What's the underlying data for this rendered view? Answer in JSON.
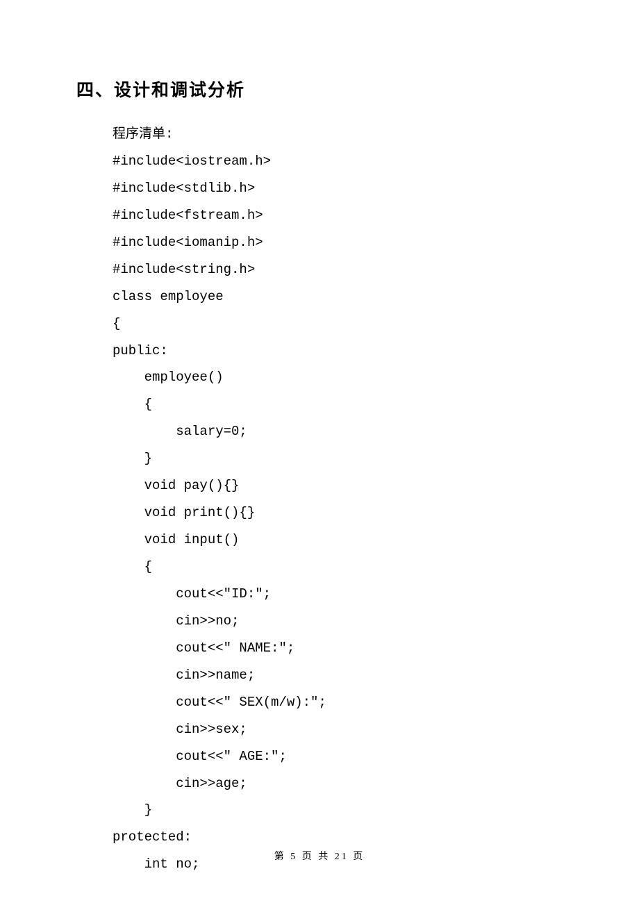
{
  "heading": "四、设计和调试分析",
  "lines": [
    "程序清单:",
    "#include<iostream.h>",
    "#include<stdlib.h>",
    "#include<fstream.h>",
    "#include<iomanip.h>",
    "#include<string.h>",
    "class employee",
    "{",
    "public:",
    "    employee()",
    "    {",
    "        salary=0;",
    "    }",
    "    void pay(){}",
    "    void print(){}",
    "    void input()",
    "    {",
    "        cout<<\"ID:\";",
    "        cin>>no;",
    "        cout<<\" NAME:\";",
    "        cin>>name;",
    "        cout<<\" SEX(m/w):\";",
    "        cin>>sex;",
    "        cout<<\" AGE:\";",
    "        cin>>age;",
    "    }",
    "protected:",
    "    int no;"
  ],
  "footer": "第 5 页 共 21 页"
}
